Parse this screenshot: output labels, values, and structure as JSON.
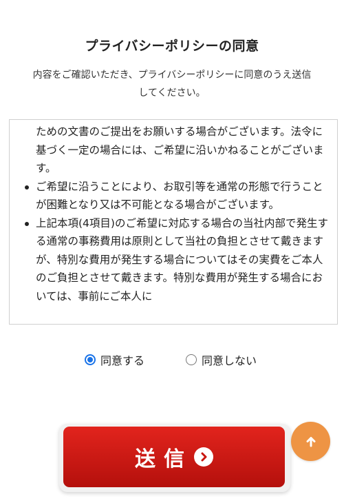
{
  "title": "プライバシーポリシーの同意",
  "intro": {
    "line1": "内容をご確認いただき、プライバシーポリシーに同意のうえ送信",
    "line2": "してください。"
  },
  "policy": {
    "continuation": "ための文書のご提出をお願いする場合がございます。法令に基づく一定の場合には、ご希望に沿いかねることがございます。",
    "items": [
      "ご希望に沿うことにより、お取引等を通常の形態で行うことが困難となり又は不可能となる場合がございます。",
      "上記本項(4項目)のご希望に対応する場合の当社内部で発生する通常の事務費用は原則として当社の負担とさせて戴きますが、特別な費用が発生する場合についてはその実費をご本人のご負担とさせて戴きます。特別な費用が発生する場合においては、事前にご本人に"
    ]
  },
  "consent": {
    "agree_label": "同意する",
    "disagree_label": "同意しない",
    "selected": "agree"
  },
  "submit": {
    "label": "送信",
    "icon": "chevron-right-circle-icon"
  },
  "scroll_top": {
    "icon": "arrow-up-icon"
  },
  "colors": {
    "submit": "#c8160f",
    "scroll_top": "#ee9444",
    "radio_accent": "#1a73e8"
  }
}
